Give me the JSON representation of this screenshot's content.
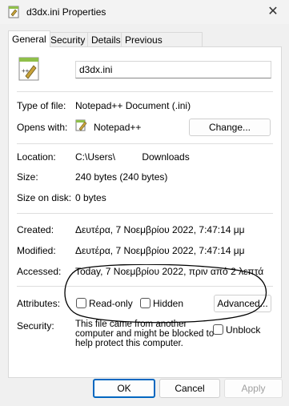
{
  "window": {
    "title": "d3dx.ini Properties",
    "close_glyph": "✕"
  },
  "tabs": [
    "General",
    "Security",
    "Details",
    "Previous Versions"
  ],
  "general": {
    "file_name": "d3dx.ini",
    "type_label": "Type of file:",
    "type_value": "Notepad++ Document (.ini)",
    "opens_label": "Opens with:",
    "opens_value": "Notepad++",
    "change_button": "Change...",
    "location_label": "Location:",
    "location_value": "C:\\Users\\          Downloads",
    "size_label": "Size:",
    "size_value": "240 bytes (240 bytes)",
    "size_disk_label": "Size on disk:",
    "size_disk_value": "0 bytes",
    "created_label": "Created:",
    "created_value": "Δευτέρα, 7 Νοεμβρίου 2022, 7:47:14 μμ",
    "modified_label": "Modified:",
    "modified_value": "Δευτέρα, 7 Νοεμβρίου 2022, 7:47:14 μμ",
    "accessed_label": "Accessed:",
    "accessed_value": "Today, 7 Νοεμβρίου 2022, πριν από 2 λεπτά",
    "attributes_label": "Attributes:",
    "readonly_label": "Read-only",
    "hidden_label": "Hidden",
    "advanced_button": "Advanced...",
    "security_label": "Security:",
    "security_line1": "This file came from another",
    "security_line2": "computer and might be blocked to",
    "security_line3": "help protect this computer.",
    "unblock_label": "Unblock"
  },
  "footer": {
    "ok": "OK",
    "cancel": "Cancel",
    "apply": "Apply"
  },
  "colors": {
    "accent": "#0067c0",
    "apply_disabled": "#a0a0a0"
  },
  "icons": {
    "window": "notepad-file-icon",
    "opens_with": "notepad-plus-plus-icon",
    "close": "close-icon"
  }
}
